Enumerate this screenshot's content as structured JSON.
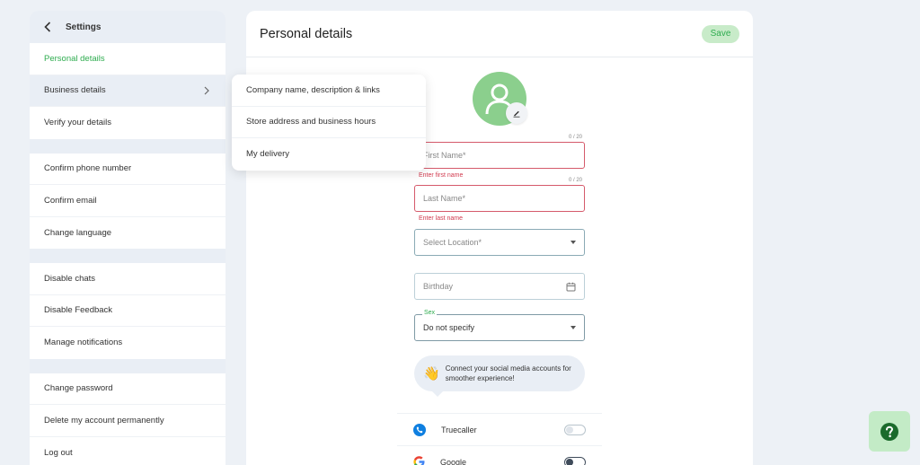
{
  "sidebar": {
    "header_title": "Settings",
    "groups": [
      [
        {
          "label": "Personal details"
        },
        {
          "label": "Business details"
        },
        {
          "label": "Verify your details"
        }
      ],
      [
        {
          "label": "Confirm phone number"
        },
        {
          "label": "Confirm email"
        },
        {
          "label": "Change language"
        }
      ],
      [
        {
          "label": "Disable chats"
        },
        {
          "label": "Disable Feedback"
        },
        {
          "label": "Manage notifications"
        }
      ],
      [
        {
          "label": "Change password"
        },
        {
          "label": "Delete my account permanently"
        },
        {
          "label": "Log out"
        }
      ]
    ]
  },
  "flyout": {
    "items": [
      {
        "label": "Company name, description & links"
      },
      {
        "label": "Store address and business hours"
      },
      {
        "label": "My delivery"
      }
    ]
  },
  "main": {
    "title": "Personal details",
    "save_label": "Save"
  },
  "form": {
    "first_name": {
      "placeholder": "First Name*",
      "counter": "0 / 20",
      "error": "Enter first name"
    },
    "last_name": {
      "placeholder": "Last Name*",
      "counter": "0 / 20",
      "error": "Enter last name"
    },
    "location": {
      "placeholder": "Select Location*"
    },
    "birthday": {
      "placeholder": "Birthday"
    },
    "sex": {
      "legend": "Sex",
      "value": "Do not specify"
    }
  },
  "social": {
    "prompt": "Connect your social media accounts for smoother experience!",
    "accounts": [
      {
        "label": "Truecaller"
      },
      {
        "label": "Google"
      }
    ]
  },
  "colors": {
    "accent": "#2eac4f",
    "error": "#d13a4e",
    "avatar": "#8bcf8d"
  }
}
